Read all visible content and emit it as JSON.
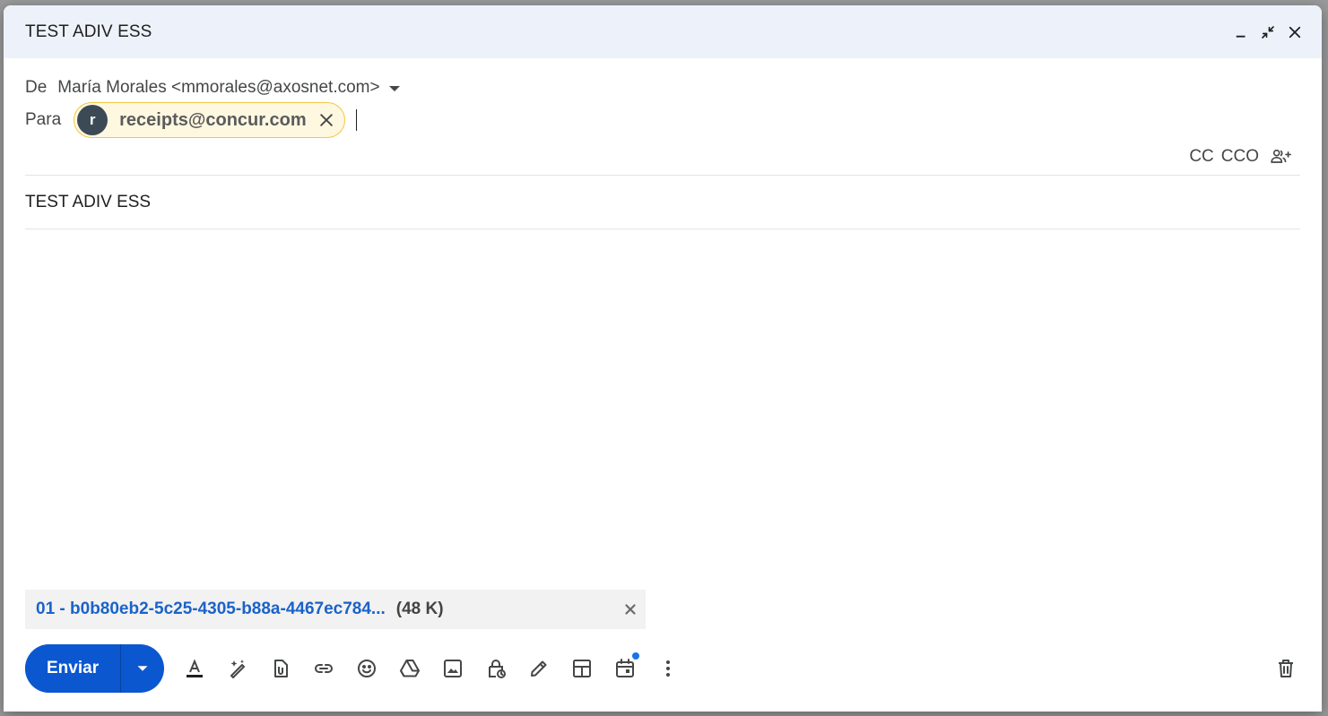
{
  "window": {
    "title": "TEST ADIV ESS",
    "controls": [
      "minimize-icon",
      "exit-fullscreen-icon",
      "close-icon"
    ]
  },
  "from": {
    "label": "De",
    "value": "María Morales <mmorales@axosnet.com>"
  },
  "to": {
    "label": "Para",
    "recipients": [
      {
        "avatar_letter": "r",
        "email": "receipts@concur.com"
      }
    ]
  },
  "cc": {
    "cc_label": "CC",
    "bcc_label": "CCO"
  },
  "subject": {
    "value": "TEST ADIV ESS"
  },
  "body": {
    "value": ""
  },
  "attachment": {
    "name": "01 - b0b80eb2-5c25-4305-b88a-4467ec784...",
    "size": "(48 K)"
  },
  "toolbar": {
    "send_label": "Enviar",
    "tools": [
      "text-format-icon",
      "magic-write-icon",
      "attach-file-icon",
      "insert-link-icon",
      "emoji-icon",
      "drive-icon",
      "insert-photo-icon",
      "confidential-mode-icon",
      "signature-icon",
      "layout-icon",
      "schedule-event-icon",
      "more-options-icon",
      "trash-icon"
    ]
  },
  "colors": {
    "accent": "#0b57d0",
    "titlebar_bg": "#edf2fa",
    "chip_border": "#f4c542",
    "chip_bg": "#fff8e1",
    "attachment_link": "#1a63c9"
  }
}
